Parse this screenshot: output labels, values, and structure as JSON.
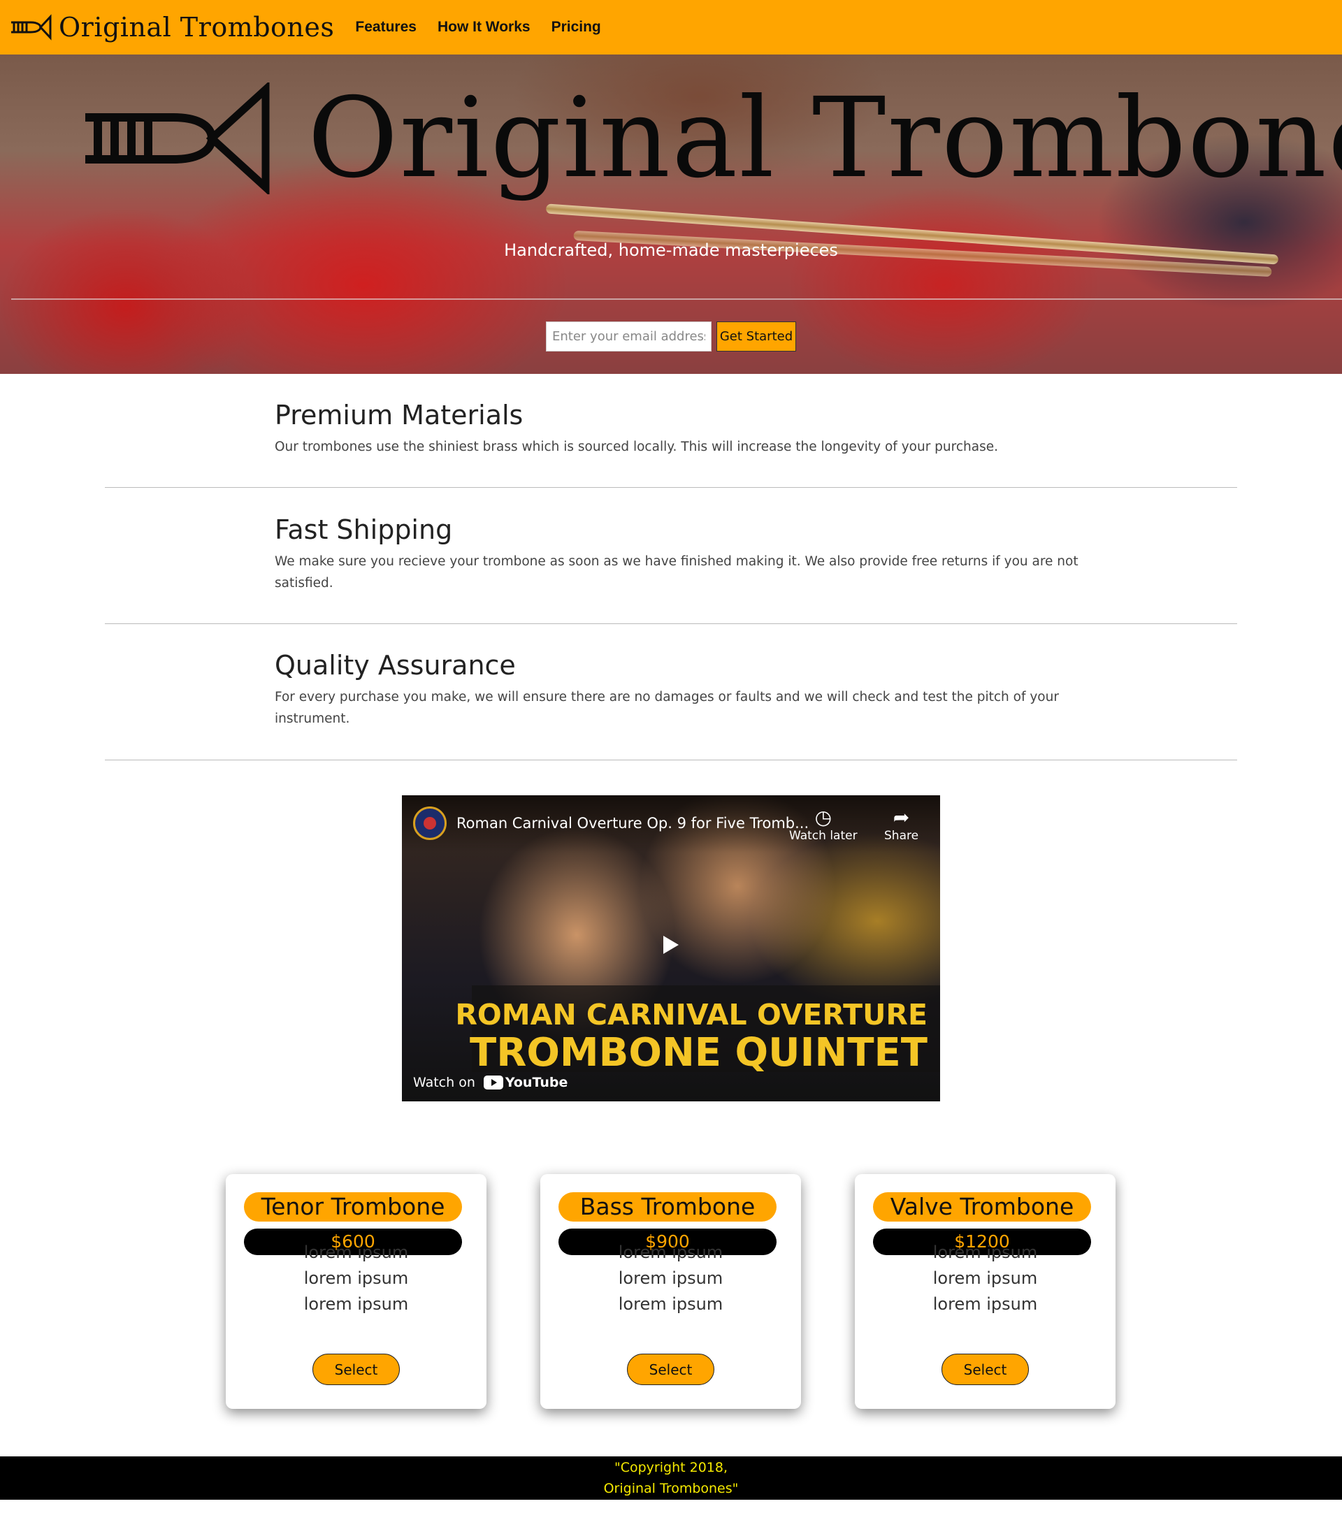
{
  "nav": {
    "logo_icon": "trombone-logo-icon",
    "brand": "Original Trombones",
    "links": [
      "Features",
      "How It Works",
      "Pricing"
    ],
    "background": "#ffa500"
  },
  "hero": {
    "title": "Original Trombones",
    "tagline": "Handcrafted, home-made masterpieces",
    "email_placeholder": "Enter your email address",
    "cta_label": "Get Started"
  },
  "features": [
    {
      "title": "Premium Materials",
      "text": "Our trombones use the shiniest brass which is sourced locally. This will increase the longevity of your purchase."
    },
    {
      "title": "Fast Shipping",
      "text": "We make sure you recieve your trombone as soon as we have finished making it. We also provide free returns if you are not satisfied."
    },
    {
      "title": "Quality Assurance",
      "text": "For every purchase you make, we will ensure there are no damages or faults and we will check and test the pitch of your instrument."
    }
  ],
  "video": {
    "title": "Roman Carnival Overture Op. 9 for Five Tromb...",
    "watch_later": "Watch later",
    "share": "Share",
    "banner_line1": "ROMAN CARNIVAL OVERTURE",
    "banner_line2": "TROMBONE QUINTET",
    "watch_on": "Watch on",
    "platform": "YouTube"
  },
  "pricing": [
    {
      "name": "Tenor Trombone",
      "price": "$600",
      "features": [
        "lorem ipsum",
        "lorem ipsum",
        "lorem ipsum"
      ],
      "button": "Select"
    },
    {
      "name": "Bass Trombone",
      "price": "$900",
      "features": [
        "lorem ipsum",
        "lorem ipsum",
        "lorem ipsum"
      ],
      "button": "Select"
    },
    {
      "name": "Valve Trombone",
      "price": "$1200",
      "features": [
        "lorem ipsum",
        "lorem ipsum",
        "lorem ipsum"
      ],
      "button": "Select"
    }
  ],
  "footer": {
    "line1": "\"Copyright 2018,",
    "line2": "Original Trombones\""
  },
  "colors": {
    "accent": "#ffa500",
    "footer_text": "#f4e800",
    "banner_text": "#f4c526"
  }
}
